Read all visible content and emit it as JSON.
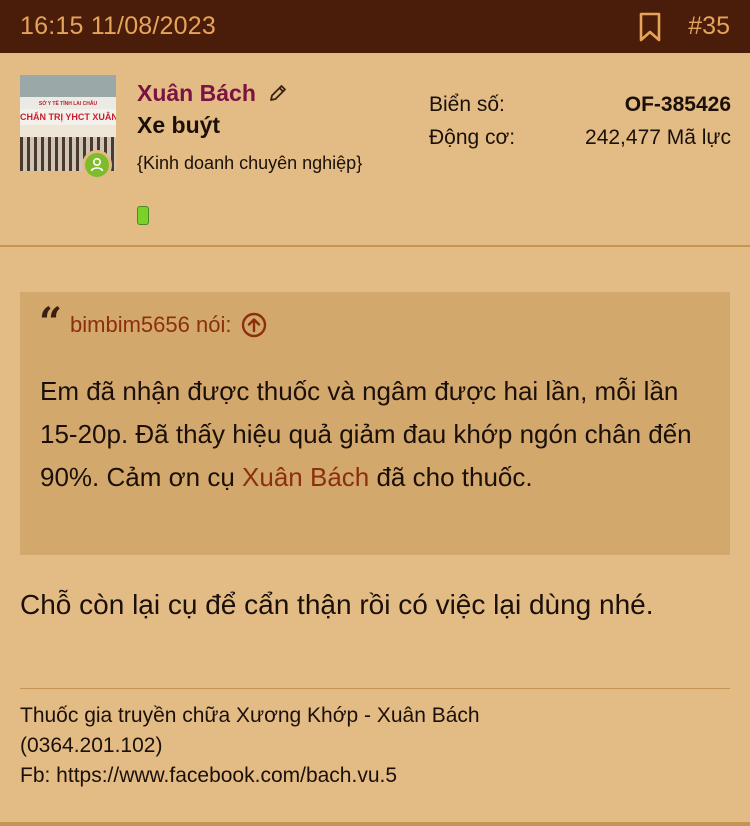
{
  "header": {
    "timestamp": "16:15 11/08/2023",
    "post_number": "#35"
  },
  "user": {
    "avatar_sign_top": "SỞ Y TẾ TỈNH LAI CHÂU",
    "avatar_sign_main": "CHẨN TRỊ YHCT XUÂN",
    "name": "Xuân Bách",
    "title": "Xe buýt",
    "description": "{Kinh doanh chuyên nghiệp}",
    "plate_label": "Biển số:",
    "plate_value": "OF-385426",
    "engine_label": "Động cơ:",
    "engine_value": "242,477 Mã lực"
  },
  "quote": {
    "author": "bimbim5656 nói:",
    "text_before": "Em đã nhận được thuốc và ngâm được hai lần, mỗi lần 15-20p. Đã thấy hiệu quả giảm đau khớp ngón chân đến 90%. Cảm ơn cụ ",
    "mention": "Xuân Bách",
    "text_after": " đã cho thuốc."
  },
  "reply": {
    "text": "Chỗ còn lại cụ để cẩn thận rồi có việc lại dùng nhé."
  },
  "signature": {
    "line1": "Thuốc gia truyền chữa Xương Khớp - Xuân Bách",
    "line2": "(0364.201.102)",
    "line3": "Fb: https://www.facebook.com/bach.vu.5"
  },
  "colors": {
    "background": "#e3bc85",
    "header_bg": "#4a1c0a",
    "header_text": "#e6a45a",
    "username": "#7a1242",
    "quote_bg": "#d3a86c",
    "link": "#8c2f0e",
    "online": "#7ebc2b"
  },
  "icons": [
    "bookmark-icon",
    "pencil-icon",
    "online-status-icon",
    "quote-mark-icon",
    "arrow-up-circle-icon",
    "badge-bar-icon"
  ]
}
